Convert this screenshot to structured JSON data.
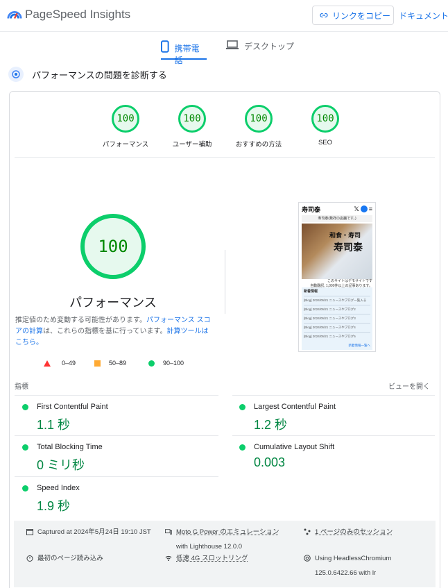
{
  "header": {
    "brand": "PageSpeed Insights",
    "copy_link": "リンクをコピー",
    "docs": "ドキュメント"
  },
  "tabs": [
    {
      "label": "携帯電話",
      "active": true
    },
    {
      "label": "デスクトップ",
      "active": false
    }
  ],
  "diagnose_title": "パフォーマンスの問題を診断する",
  "categories": [
    {
      "score": "100",
      "label": "パフォーマンス"
    },
    {
      "score": "100",
      "label": "ユーザー補助"
    },
    {
      "score": "100",
      "label": "おすすめの方法"
    },
    {
      "score": "100",
      "label": "SEO"
    }
  ],
  "performance": {
    "score": "100",
    "title": "パフォーマンス",
    "note_prefix": "推定値のため変動する可能性があります。",
    "note_link1": "パフォーマンス スコアの計算",
    "note_mid": "は、これらの指標を基に行っています。",
    "note_link2": "計算ツールはこちら。"
  },
  "legend": [
    {
      "range": "0–49",
      "color": "#ff3333",
      "shape": "triangle"
    },
    {
      "range": "50–89",
      "color": "#ffaa33",
      "shape": "square"
    },
    {
      "range": "90–100",
      "color": "#0cce6b",
      "shape": "circle"
    }
  ],
  "screenshot": {
    "logo": "寿司泰",
    "banner": "寿司泰(発祥の店舗です。)",
    "hero_line1": "和食・寿司",
    "hero_line2": "寿司泰",
    "sub1": "このサイトはデモサイトです",
    "sub2": "自動翻訳, 1,000件以上の記事あります。",
    "news_heading": "新着情報",
    "news_items": [
      "[Blog] 2024/05/21 ニュースやブログ一覧入る",
      "[Blog] 2024/05/21 ニュースやブログ2",
      "[Blog] 2024/05/21 ニュースやブログ3",
      "[Blog] 2024/05/21 ニュースやブログ4",
      "[Blog] 2024/05/21 ニュースやブログ5"
    ],
    "news_more": "新着情報一覧へ"
  },
  "metrics": {
    "heading": "指標",
    "expand": "ビューを開く",
    "items": [
      {
        "name": "First Contentful Paint",
        "value": "1.1 秒"
      },
      {
        "name": "Largest Contentful Paint",
        "value": "1.2 秒"
      },
      {
        "name": "Total Blocking Time",
        "value": "0 ミリ秒"
      },
      {
        "name": "Cumulative Layout Shift",
        "value": "0.003"
      },
      {
        "name": "Speed Index",
        "value": "1.9 秒"
      }
    ]
  },
  "run_info": {
    "captured": "Captured at 2024年5月24日 19:10 JST",
    "device": "Moto G Power のエミュレーション",
    "lighthouse": "with Lighthouse 12.0.0",
    "session": "1 ページのみのセッション",
    "initial_load": "最初のページ読み込み",
    "throttling": "低速 4G スロットリング",
    "browser": "Using HeadlessChromium",
    "browser_version": "125.0.6422.66 with lr"
  }
}
